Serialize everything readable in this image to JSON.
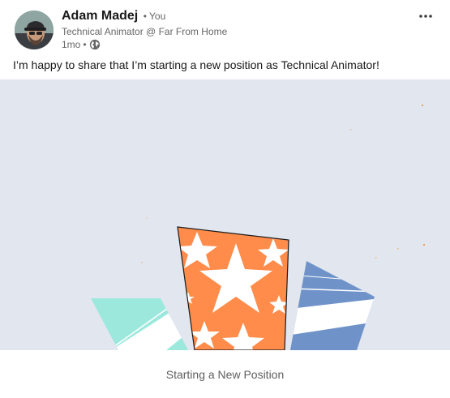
{
  "author": {
    "name": "Adam Madej",
    "degree": "• You",
    "headline": "Technical Animator @ Far From Home",
    "time": "1mo",
    "separator": "•",
    "visibility_icon": "globe-icon"
  },
  "menu": {
    "icon": "more-horizontal-icon"
  },
  "post": {
    "text": "I’m happy to share that I’m starting a new position as Technical Animator!"
  },
  "media": {
    "caption": "Starting a New Position",
    "colors": {
      "background": "#e1e6ef",
      "orange": "#ff8c4a",
      "teal": "#9de8dd",
      "blue": "#6f93c9"
    }
  }
}
